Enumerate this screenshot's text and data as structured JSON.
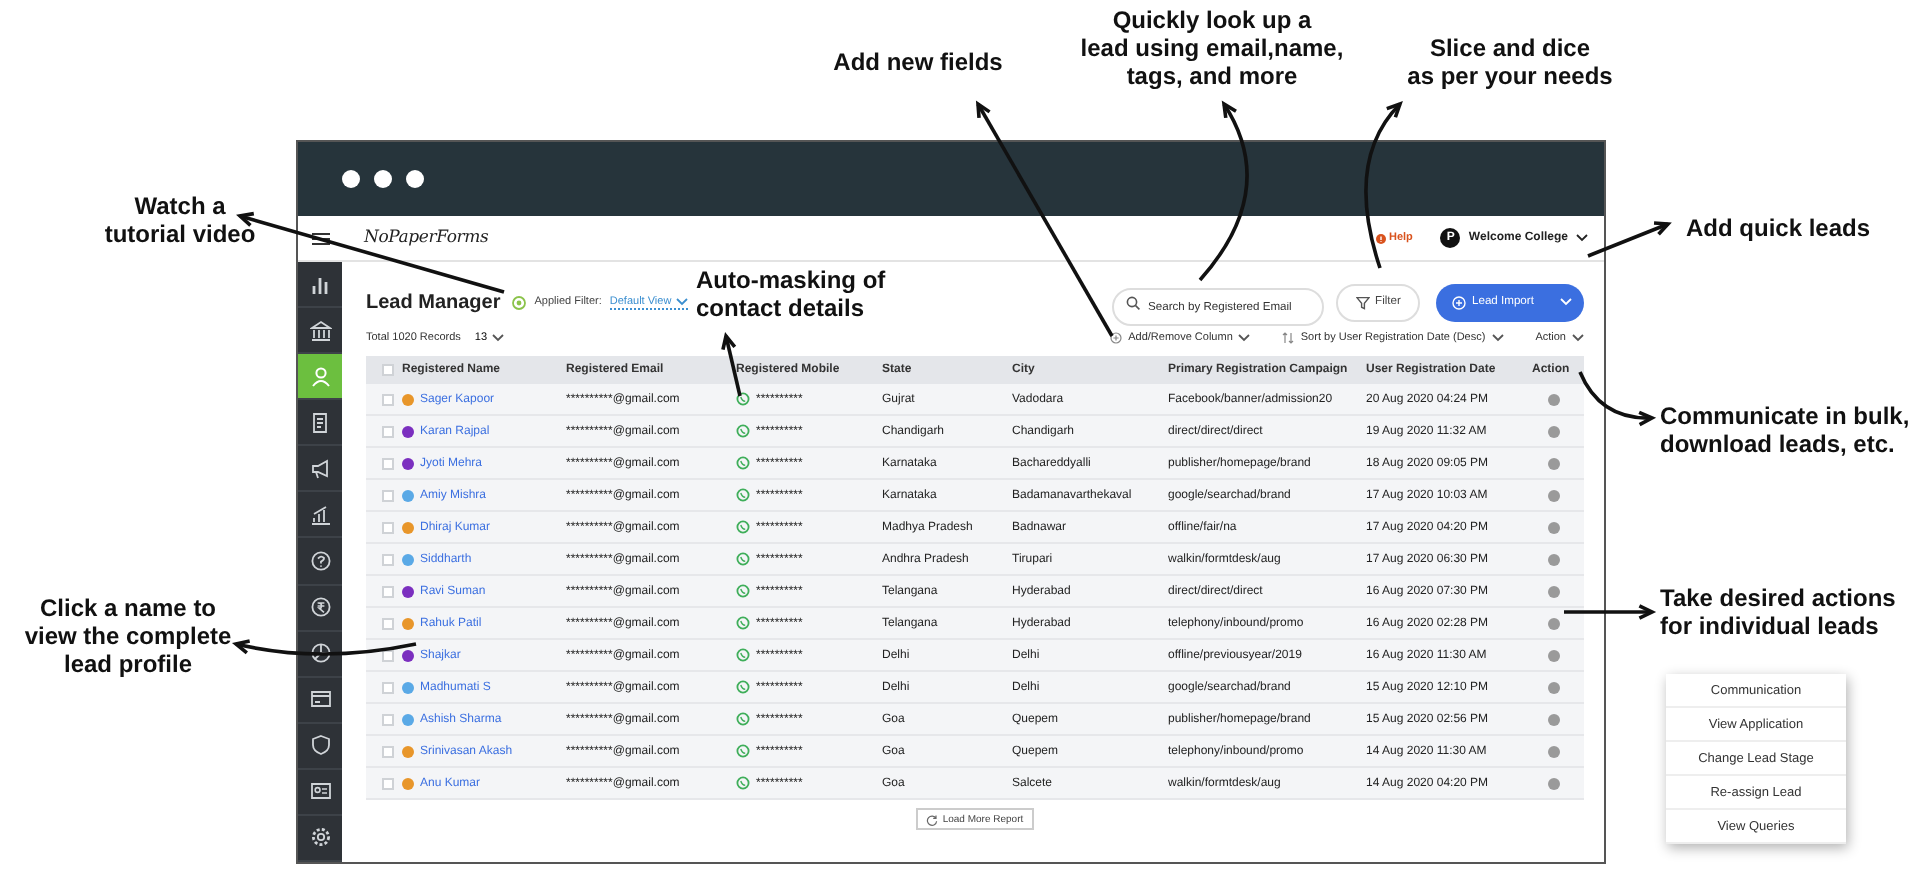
{
  "annotations": [
    {
      "lines": [
        "Add new fields"
      ]
    },
    {
      "lines": [
        "Quickly look up a",
        "lead using email,name,",
        "tags, and more"
      ]
    },
    {
      "lines": [
        "Slice and dice",
        "as per your needs"
      ]
    },
    {
      "lines": [
        "Watch a",
        "tutorial video"
      ]
    },
    {
      "lines": [
        "Add quick leads"
      ]
    },
    {
      "lines": [
        "Auto-masking of",
        "contact details"
      ]
    },
    {
      "lines": [
        "Communicate in bulk,",
        "download leads, etc."
      ]
    },
    {
      "lines": [
        "Click a name to",
        "view the complete",
        "lead profile"
      ]
    },
    {
      "lines": [
        "Take desired actions",
        "for individual leads"
      ]
    }
  ],
  "app": {
    "header": {
      "logo": "NoPaperForms",
      "help": "Help",
      "account": {
        "initial": "P",
        "name": "Welcome College"
      }
    },
    "sidebar": {
      "items": [
        {
          "selected": false
        },
        {
          "selected": false
        },
        {
          "selected": true
        },
        {
          "selected": false
        },
        {
          "selected": false
        },
        {
          "selected": false
        },
        {
          "selected": false
        },
        {
          "selected": false
        },
        {
          "selected": false
        },
        {
          "selected": false
        },
        {
          "selected": false
        },
        {
          "selected": false
        },
        {
          "selected": false
        }
      ]
    },
    "page": {
      "title": "Lead Manager",
      "filter_label": "Applied Filter:",
      "filter_value": "Default View",
      "search": {
        "placeholder": "Search by Registered Email"
      },
      "filter_button": "Filter",
      "import_button": "Lead Import",
      "total_records": "Total 1020 Records",
      "page_size": "13",
      "add_remove_column": "Add/Remove Column",
      "sort": "Sort by User Registration Date (Desc)",
      "action": "Action"
    },
    "table": {
      "select_all_checked": false,
      "columns": [
        "Registered Name",
        "Registered Email",
        "Registered Mobile",
        "State",
        "City",
        "Primary Registration Campaign",
        "User Registration Date",
        "Action"
      ],
      "rows": [
        {
          "checked": false,
          "color": "#e8962a",
          "name": "Sager Kapoor",
          "email": "**********@gmail.com",
          "mobile": "**********",
          "state": "Gujrat",
          "city": "Vadodara",
          "campaign": "Facebook/banner/admission20",
          "date": "20 Aug 2020 04:24 PM"
        },
        {
          "checked": false,
          "color": "#7b2fbf",
          "name": "Karan Rajpal",
          "email": "**********@gmail.com",
          "mobile": "**********",
          "state": "Chandigarh",
          "city": "Chandigarh",
          "campaign": "direct/direct/direct",
          "date": "19 Aug 2020 11:32 AM"
        },
        {
          "checked": false,
          "color": "#7b2fbf",
          "name": "Jyoti Mehra",
          "email": "**********@gmail.com",
          "mobile": "**********",
          "state": "Karnataka",
          "city": "Bachareddyalli",
          "campaign": "publisher/homepage/brand",
          "date": "18 Aug 2020 09:05 PM"
        },
        {
          "checked": false,
          "color": "#5aa9e6",
          "name": "Amiy Mishra",
          "email": "**********@gmail.com",
          "mobile": "**********",
          "state": "Karnataka",
          "city": "Badamanavarthekaval",
          "campaign": "google/searchad/brand",
          "date": "17 Aug 2020 10:03 AM"
        },
        {
          "checked": false,
          "color": "#e8962a",
          "name": "Dhiraj Kumar",
          "email": "**********@gmail.com",
          "mobile": "**********",
          "state": "Madhya Pradesh",
          "city": "Badnawar",
          "campaign": "offline/fair/na",
          "date": "17 Aug 2020 04:20 PM"
        },
        {
          "checked": false,
          "color": "#5aa9e6",
          "name": "Siddharth",
          "email": "**********@gmail.com",
          "mobile": "**********",
          "state": "Andhra Pradesh",
          "city": "Tirupari",
          "campaign": "walkin/formtdesk/aug",
          "date": "17 Aug 2020 06:30 PM"
        },
        {
          "checked": false,
          "color": "#7b2fbf",
          "name": "Ravi Suman",
          "email": "**********@gmail.com",
          "mobile": "**********",
          "state": "Telangana",
          "city": "Hyderabad",
          "campaign": "direct/direct/direct",
          "date": "16 Aug 2020 07:30 PM"
        },
        {
          "checked": false,
          "color": "#e8962a",
          "name": "Rahuk Patil",
          "email": "**********@gmail.com",
          "mobile": "**********",
          "state": "Telangana",
          "city": "Hyderabad",
          "campaign": "telephony/inbound/promo",
          "date": "16 Aug 2020 02:28 PM"
        },
        {
          "checked": false,
          "color": "#7b2fbf",
          "name": "Shajkar",
          "email": "**********@gmail.com",
          "mobile": "**********",
          "state": "Delhi",
          "city": "Delhi",
          "campaign": "offline/previousyear/2019",
          "date": "16 Aug 2020 11:30 AM"
        },
        {
          "checked": false,
          "color": "#5aa9e6",
          "name": "Madhumati S",
          "email": "**********@gmail.com",
          "mobile": "**********",
          "state": "Delhi",
          "city": "Delhi",
          "campaign": "google/searchad/brand",
          "date": "15 Aug 2020 12:10 PM"
        },
        {
          "checked": false,
          "color": "#5aa9e6",
          "name": "Ashish Sharma",
          "email": "**********@gmail.com",
          "mobile": "**********",
          "state": "Goa",
          "city": "Quepem",
          "campaign": "publisher/homepage/brand",
          "date": "15 Aug 2020 02:56 PM"
        },
        {
          "checked": false,
          "color": "#e8962a",
          "name": "Srinivasan Akash",
          "email": "**********@gmail.com",
          "mobile": "**********",
          "state": "Goa",
          "city": "Quepem",
          "campaign": "telephony/inbound/promo",
          "date": "14 Aug 2020 11:30 AM"
        },
        {
          "checked": false,
          "color": "#e8962a",
          "name": "Anu Kumar",
          "email": "**********@gmail.com",
          "mobile": "**********",
          "state": "Goa",
          "city": "Salcete",
          "campaign": "walkin/formtdesk/aug",
          "date": "14 Aug 2020 04:20 PM"
        }
      ]
    },
    "load_more": "Load More Report"
  },
  "action_menu": {
    "items": [
      "Communication",
      "View Application",
      "Change Lead Stage",
      "Re-assign Lead",
      "View Queries"
    ]
  }
}
